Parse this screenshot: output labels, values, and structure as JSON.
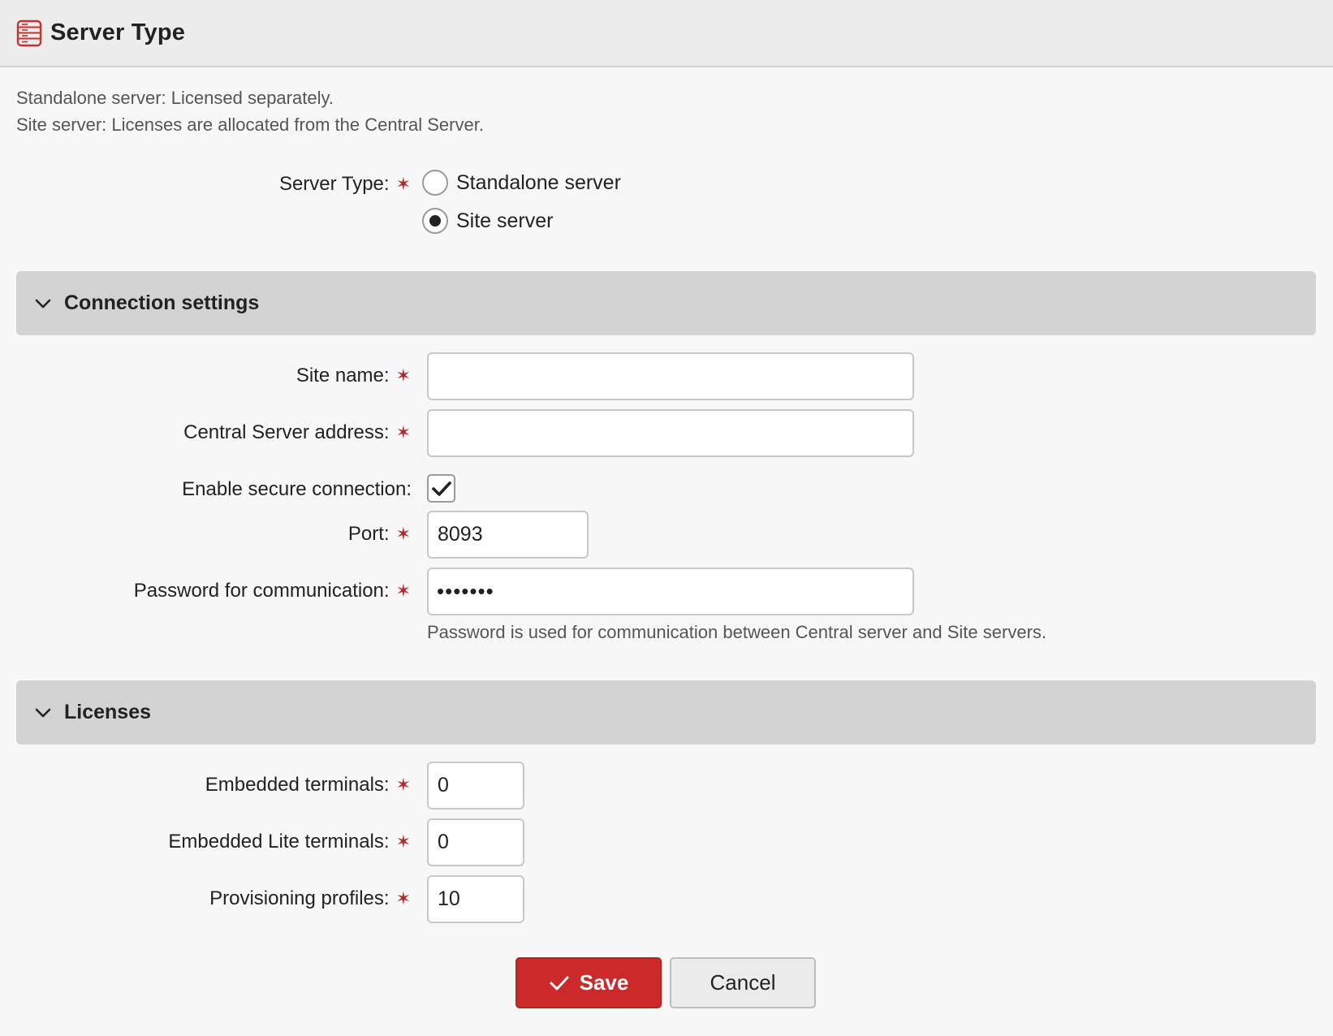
{
  "header": {
    "title": "Server Type",
    "icon": "server-stack-icon",
    "icon_color": "#c8322d"
  },
  "description": {
    "line1": "Standalone server: Licensed separately.",
    "line2": "Site server: Licenses are allocated from the Central Server."
  },
  "server_type": {
    "label": "Server Type:",
    "options": [
      {
        "label": "Standalone server",
        "selected": false
      },
      {
        "label": "Site server",
        "selected": true
      }
    ]
  },
  "connection": {
    "title": "Connection settings",
    "site_name": {
      "label": "Site name:",
      "value": ""
    },
    "central_address": {
      "label": "Central Server address:",
      "value": ""
    },
    "secure": {
      "label": "Enable secure connection:",
      "checked": true
    },
    "port": {
      "label": "Port:",
      "value": "8093"
    },
    "password": {
      "label": "Password for communication:",
      "masked": "•••••••",
      "hint": "Password is used for communication between Central server and Site servers."
    }
  },
  "licenses": {
    "title": "Licenses",
    "embedded": {
      "label": "Embedded terminals:",
      "value": "0"
    },
    "embedded_lite": {
      "label": "Embedded Lite terminals:",
      "value": "0"
    },
    "provisioning": {
      "label": "Provisioning profiles:",
      "value": "10"
    }
  },
  "required_marker": "✶",
  "actions": {
    "save": "Save",
    "cancel": "Cancel"
  },
  "colors": {
    "accent": "#cc2a2a",
    "required": "#b5282a",
    "section_bg": "#d3d3d3"
  }
}
